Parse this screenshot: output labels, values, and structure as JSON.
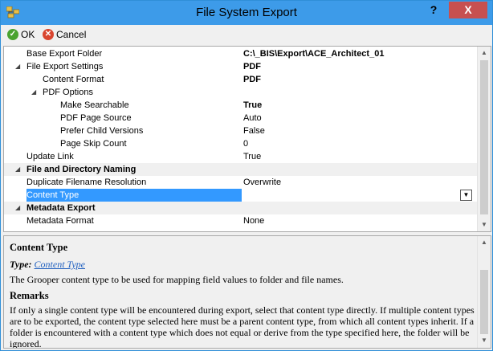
{
  "window": {
    "title": "File System Export",
    "help_label": "?",
    "close_label": "X"
  },
  "toolbar": {
    "ok_label": "OK",
    "cancel_label": "Cancel"
  },
  "grid": {
    "rows": [
      {
        "name": "Base Export Folder",
        "value": "C:\\_BIS\\Export\\ACE_Architect_01"
      },
      {
        "name": "File Export Settings",
        "value": "PDF",
        "expander": "◢"
      },
      {
        "name": "Content Format",
        "value": "PDF"
      },
      {
        "name": "PDF Options",
        "value": "",
        "expander": "◢"
      },
      {
        "name": "Make Searchable",
        "value": "True"
      },
      {
        "name": "PDF Page Source",
        "value": "Auto"
      },
      {
        "name": "Prefer Child Versions",
        "value": "False"
      },
      {
        "name": "Page Skip Count",
        "value": "0"
      },
      {
        "name": "Update Link",
        "value": "True"
      },
      {
        "name": "File and Directory Naming",
        "value": "",
        "expander": "◢"
      },
      {
        "name": "Duplicate Filename Resolution",
        "value": "Overwrite"
      },
      {
        "name": "Content Type",
        "value": ""
      },
      {
        "name": "Metadata Export",
        "value": "",
        "expander": "◢"
      },
      {
        "name": "Metadata Format",
        "value": "None"
      }
    ]
  },
  "help": {
    "title": "Content Type",
    "type_label": "Type:",
    "type_link": "Content Type",
    "description": "The Grooper content type to be used for mapping field values to folder and file names.",
    "remarks_title": "Remarks",
    "remarks_text": "If only a single content type will be encountered during export, select that content type directly. If multiple content types are to be exported, the content type selected here must be a parent content type, from which all content types inherit. If a folder is encountered with a content type which does not equal or derive from the type specified here, the folder will be ignored."
  },
  "colors": {
    "titlebar": "#3d9be9",
    "close": "#c75050",
    "selection": "#3399ff",
    "link": "#1f5fbf"
  }
}
